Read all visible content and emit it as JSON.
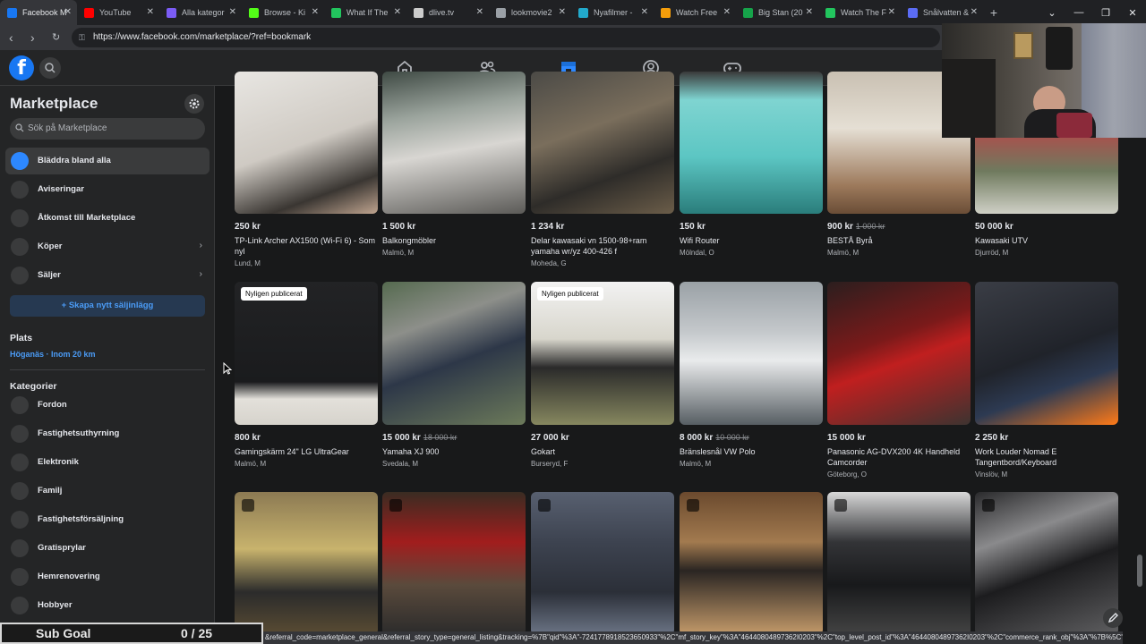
{
  "browser": {
    "tabs": [
      {
        "label": "Facebook M",
        "color": "#1877f2",
        "icon": "facebook-icon",
        "active": true
      },
      {
        "label": "YouTube",
        "color": "#ff0000",
        "icon": "youtube-icon"
      },
      {
        "label": "Alla kategor",
        "color": "#7b5cf5",
        "icon": "page-icon"
      },
      {
        "label": "Browse - Ki",
        "color": "#53fc18",
        "icon": "kick-icon"
      },
      {
        "label": "What If The",
        "color": "#22c55e",
        "icon": "play-icon"
      },
      {
        "label": "dlive.tv",
        "color": "#cccccc",
        "icon": "globe-icon"
      },
      {
        "label": "lookmovie2",
        "color": "#9aa0a6",
        "icon": "globe-icon"
      },
      {
        "label": "Nyafilmer -",
        "color": "#22aacc",
        "icon": "page-icon"
      },
      {
        "label": "Watch Free",
        "color": "#f59e0b",
        "icon": "page-icon"
      },
      {
        "label": "Big Stan (20",
        "color": "#16a34a",
        "icon": "page-icon"
      },
      {
        "label": "Watch The F",
        "color": "#22c55e",
        "icon": "play-icon"
      },
      {
        "label": "Snålvatten &",
        "color": "#5b6cf5",
        "icon": "page-icon"
      }
    ],
    "url": "https://www.facebook.com/marketplace/?ref=bookmark"
  },
  "sidebar": {
    "title": "Marketplace",
    "search_placeholder": "Sök på Marketplace",
    "items": [
      {
        "label": "Bläddra bland alla",
        "icon": "storefront-icon",
        "active": true
      },
      {
        "label": "Aviseringar",
        "icon": "bell-icon"
      },
      {
        "label": "Åtkomst till Marketplace",
        "icon": "shield-icon"
      },
      {
        "label": "Köper",
        "icon": "bag-icon",
        "chevron": true
      },
      {
        "label": "Säljer",
        "icon": "tag-icon",
        "chevron": true
      }
    ],
    "create_button": "+ Skapa nytt säljinlägg",
    "location_heading": "Plats",
    "location_value": "Höganäs · Inom 20 km",
    "categories_heading": "Kategorier",
    "categories": [
      {
        "label": "Fordon",
        "icon": "car-icon"
      },
      {
        "label": "Fastighetsuthyrning",
        "icon": "house-icon"
      },
      {
        "label": "Elektronik",
        "icon": "phone-icon"
      },
      {
        "label": "Familj",
        "icon": "heart-icon"
      },
      {
        "label": "Fastighetsförsäljning",
        "icon": "house-icon"
      },
      {
        "label": "Gratisprylar",
        "icon": "gift-icon"
      },
      {
        "label": "Hemrenovering",
        "icon": "wrench-icon"
      },
      {
        "label": "Hobbyer",
        "icon": "brush-icon"
      }
    ]
  },
  "listings": [
    {
      "price": "250 kr",
      "old_price": "",
      "title": "TP-Link Archer AX1500 (Wi-Fi 6) - Som nyl",
      "location": "Lund, M",
      "badge": ""
    },
    {
      "price": "1 500 kr",
      "old_price": "",
      "title": "Balkongmöbler",
      "location": "Malmö, M",
      "badge": ""
    },
    {
      "price": "1 234 kr",
      "old_price": "",
      "title": "Delar kawasaki vn 1500-98+ram yamaha wr/yz 400-426 f",
      "location": "Moheda, G",
      "badge": ""
    },
    {
      "price": "150 kr",
      "old_price": "",
      "title": "Wifi Router",
      "location": "Mölndal, O",
      "badge": ""
    },
    {
      "price": "900 kr",
      "old_price": "1 000 kr",
      "title": "BESTÅ Byrå",
      "location": "Malmö, M",
      "badge": ""
    },
    {
      "price": "50 000 kr",
      "old_price": "",
      "title": "Kawasaki UTV",
      "location": "Djurröd, M",
      "badge": ""
    },
    {
      "price": "800 kr",
      "old_price": "",
      "title": "Gamingskärm 24\" LG UltraGear",
      "location": "Malmö, M",
      "badge": "Nyligen publicerat"
    },
    {
      "price": "15 000 kr",
      "old_price": "18 000 kr",
      "title": "Yamaha XJ 900",
      "location": "Svedala, M",
      "badge": ""
    },
    {
      "price": "27 000 kr",
      "old_price": "",
      "title": "Gokart",
      "location": "Burseryd, F",
      "badge": "Nyligen publicerat"
    },
    {
      "price": "8 000 kr",
      "old_price": "10 000 kr",
      "title": "Bränslesnål VW Polo",
      "location": "Malmö, M",
      "badge": ""
    },
    {
      "price": "15 000 kr",
      "old_price": "",
      "title": "Panasonic AG-DVX200 4K Handheld Camcorder",
      "location": "Göteborg, O",
      "badge": ""
    },
    {
      "price": "2 250 kr",
      "old_price": "",
      "title": "Work Louder Nomad E Tangentbord/Keyboard",
      "location": "Vinslöv, M",
      "badge": ""
    },
    {
      "price": "",
      "old_price": "",
      "title": "",
      "location": "",
      "badge": ""
    },
    {
      "price": "",
      "old_price": "",
      "title": "",
      "location": "",
      "badge": ""
    },
    {
      "price": "",
      "old_price": "",
      "title": "",
      "location": "",
      "badge": ""
    },
    {
      "price": "",
      "old_price": "",
      "title": "",
      "location": "",
      "badge": ""
    },
    {
      "price": "",
      "old_price": "",
      "title": "",
      "location": "",
      "badge": ""
    },
    {
      "price": "",
      "old_price": "",
      "title": "",
      "location": "",
      "badge": ""
    }
  ],
  "overlay": {
    "sub_goal_label": "Sub Goal",
    "sub_goal_value": "0 / 25"
  },
  "status_url": "&referral_code=marketplace_general&referral_story_type=general_listing&tracking=%7B\"qid\"%3A\"-7241778918523650933\"%2C\"mf_story_key\"%3A\"46440804897362I0203\"%2C\"top_level_post_id\"%3A\"46440804897362I0203\"%2C\"commerce_rank_obj\"%3A\"%7B%5C\"ta..."
}
